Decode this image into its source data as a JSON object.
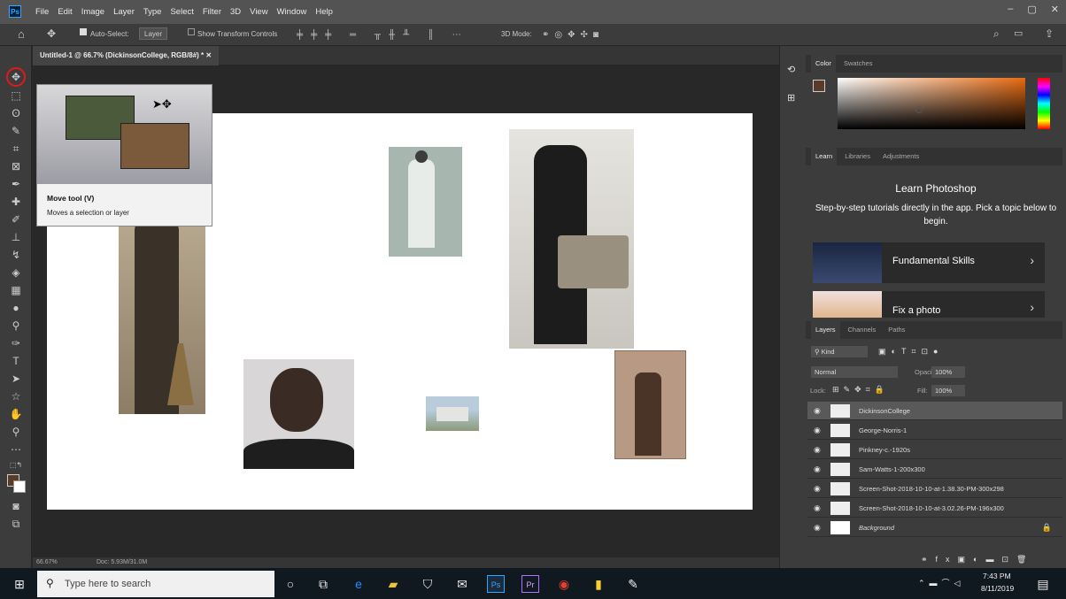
{
  "app": {
    "logo": "Ps",
    "menu": [
      "File",
      "Edit",
      "Image",
      "Layer",
      "Type",
      "Select",
      "Filter",
      "3D",
      "View",
      "Window",
      "Help"
    ]
  },
  "window_controls": [
    "–",
    "▢",
    "✕"
  ],
  "options_bar": {
    "auto_select_label": "Auto-Select:",
    "auto_select_value": "Layer",
    "show_transform": "Show Transform Controls",
    "mode_label": "3D Mode:"
  },
  "document": {
    "tab_title": "Untitled-1 @ 66.7% (DickinsonCollege, RGB/8#) *",
    "close": "✕"
  },
  "status": {
    "zoom": "66.67%",
    "doc": "Doc: 5.93M/31.0M"
  },
  "tooltip": {
    "title": "Move tool (V)",
    "desc": "Moves a selection or layer"
  },
  "color_panel": {
    "tabs": [
      "Color",
      "Swatches"
    ]
  },
  "learn_panel": {
    "tabs": [
      "Learn",
      "Libraries",
      "Adjustments"
    ],
    "title": "Learn Photoshop",
    "desc": "Step-by-step tutorials directly in the app. Pick a topic below to begin.",
    "cards": [
      {
        "label": "Fundamental Skills"
      },
      {
        "label": "Fix a photo"
      }
    ]
  },
  "layers_panel": {
    "tabs": [
      "Layers",
      "Channels",
      "Paths"
    ],
    "kind": "Kind",
    "blend": "Normal",
    "opacity_label": "Opacity:",
    "opacity": "100%",
    "lock_label": "Lock:",
    "fill_label": "Fill:",
    "fill": "100%",
    "layers": [
      {
        "name": "DickinsonCollege"
      },
      {
        "name": "George-Norris-1"
      },
      {
        "name": "Pinkney-c.-1920s"
      },
      {
        "name": "Sam-Watts-1-200x300"
      },
      {
        "name": "Screen-Shot-2018-10-10-at-1.38.30-PM-300x298"
      },
      {
        "name": "Screen-Shot-2018-10-10-at-3.02.26-PM-196x300"
      },
      {
        "name": "Background"
      }
    ]
  },
  "taskbar": {
    "search_placeholder": "Type here to search",
    "time": "7:43 PM",
    "date": "8/11/2019"
  },
  "colors": {
    "accent_red": "#e0191e",
    "fg_swatch": "#5b3a2a",
    "ps_blue": "#31a8ff"
  }
}
